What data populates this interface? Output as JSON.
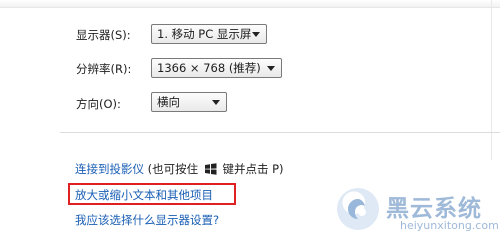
{
  "settings": {
    "display": {
      "label": "显示器(S):",
      "value": "1. 移动 PC 显示屏"
    },
    "resolution": {
      "label": "分辨率(R):",
      "value": "1366 × 768 (推荐)"
    },
    "orientation": {
      "label": "方向(O):",
      "value": "横向"
    }
  },
  "links": {
    "projector": {
      "link_text": "连接到投影仪",
      "hint_prefix": " (也可按住 ",
      "hint_suffix": " 键并点击 P)"
    },
    "enlarge_text": "放大或缩小文本和其他项目",
    "which_settings": "我应该选择什么显示器设置?"
  },
  "icons": {
    "dropdown": "chevron-down-icon",
    "windows_key": "windows-logo-icon",
    "watermark_logo": "cloud-logo-icon"
  },
  "watermark": {
    "title": "黑云系统",
    "url": "heiyunxitong.com"
  },
  "colors": {
    "link": "#1a5fb4",
    "highlight": "#e02020",
    "watermark": "#9fb9d8"
  }
}
